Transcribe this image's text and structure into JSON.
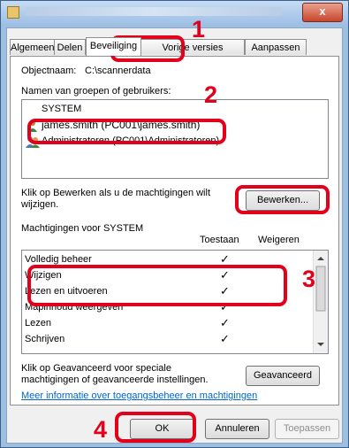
{
  "window": {
    "close_label": "x"
  },
  "tabs": [
    "Algemeen",
    "Delen",
    "Beveiliging",
    "Vorige versies",
    "Aanpassen"
  ],
  "object": {
    "label": "Objectnaam:",
    "value": "C:\\scannerdata"
  },
  "groups": {
    "label": "Namen van groepen of gebruikers:",
    "items": [
      "SYSTEM",
      "james.smith (PC001\\james.smith)",
      "Administratoren (PC001\\Administratoren)"
    ]
  },
  "edit": {
    "hint": "Klik op Bewerken als u de machtigingen wilt wijzigen.",
    "button": "Bewerken..."
  },
  "permissions": {
    "heading": "Machtigingen voor SYSTEM",
    "allow_col": "Toestaan",
    "deny_col": "Weigeren",
    "rows": [
      {
        "label": "Volledig beheer",
        "allow": "✓"
      },
      {
        "label": "Wijzigen",
        "allow": "✓"
      },
      {
        "label": "Lezen en uitvoeren",
        "allow": "✓"
      },
      {
        "label": "Mapinhoud weergeven",
        "allow": "✓"
      },
      {
        "label": "Lezen",
        "allow": "✓"
      },
      {
        "label": "Schrijven",
        "allow": "✓"
      }
    ]
  },
  "advanced": {
    "hint": "Klik op Geavanceerd voor speciale machtigingen of geavanceerde instellingen.",
    "button": "Geavanceerd"
  },
  "link": "Meer informatie over toegangsbeheer en machtigingen",
  "footer": {
    "ok": "OK",
    "cancel": "Annuleren",
    "apply": "Toepassen"
  },
  "annotations": {
    "step1": "1",
    "step2": "2",
    "step3": "3",
    "step4": "4"
  },
  "colors": {
    "annotation": "#e3001b",
    "link": "#0066cc"
  }
}
